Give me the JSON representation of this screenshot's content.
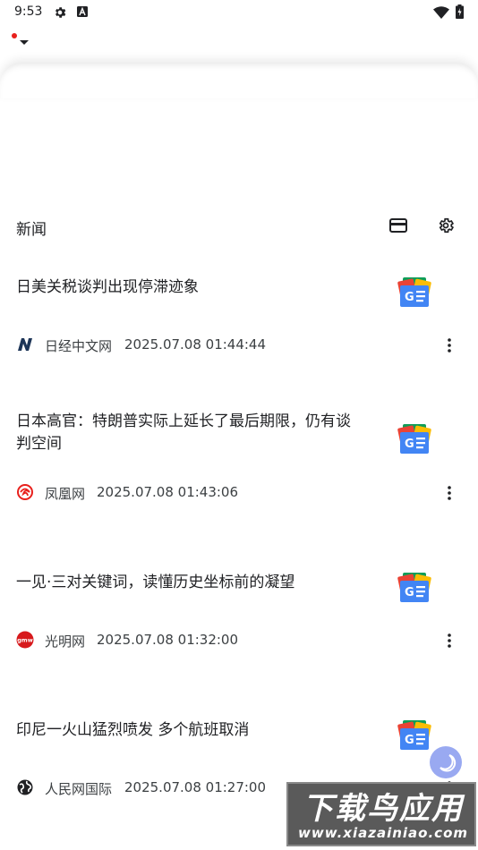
{
  "status_bar": {
    "time": "9:53",
    "icons": [
      "gear-icon",
      "a-box-icon",
      "wifi-icon",
      "battery-charging-icon"
    ]
  },
  "top_bar": {
    "notification_dot_color": "#e8201c",
    "caret_icon": "caret-down-icon"
  },
  "section": {
    "title": "新闻",
    "actions": [
      "cards-icon",
      "settings-icon"
    ]
  },
  "news": [
    {
      "title": "日美关税谈判出现停滞迹象",
      "source": "日经中文网",
      "time": "2025.07.08 01:44:44",
      "source_icon": "nikkei-icon",
      "publisher_logo": "google-news-icon"
    },
    {
      "title": "日本高官：特朗普实际上延长了最后期限，仍有谈判空间",
      "source": "凤凰网",
      "time": "2025.07.08 01:43:06",
      "source_icon": "ifeng-icon",
      "publisher_logo": "google-news-icon"
    },
    {
      "title": "一见·三对关键词，读懂历史坐标前的凝望",
      "source": "光明网",
      "time": "2025.07.08 01:32:00",
      "source_icon": "gmw-icon",
      "publisher_logo": "google-news-icon"
    },
    {
      "title": "印尼一火山猛烈喷发 多个航班取消",
      "source": "人民网国际",
      "time": "2025.07.08 01:27:00",
      "source_icon": "globe-icon",
      "publisher_logo": "google-news-icon"
    }
  ],
  "watermark": {
    "title": "下载鸟应用",
    "url": "www.xiazainiao.com"
  },
  "colors": {
    "accent_red": "#e8201c",
    "bubble": "#8fa0f0",
    "google_blue": "#4285f4"
  }
}
